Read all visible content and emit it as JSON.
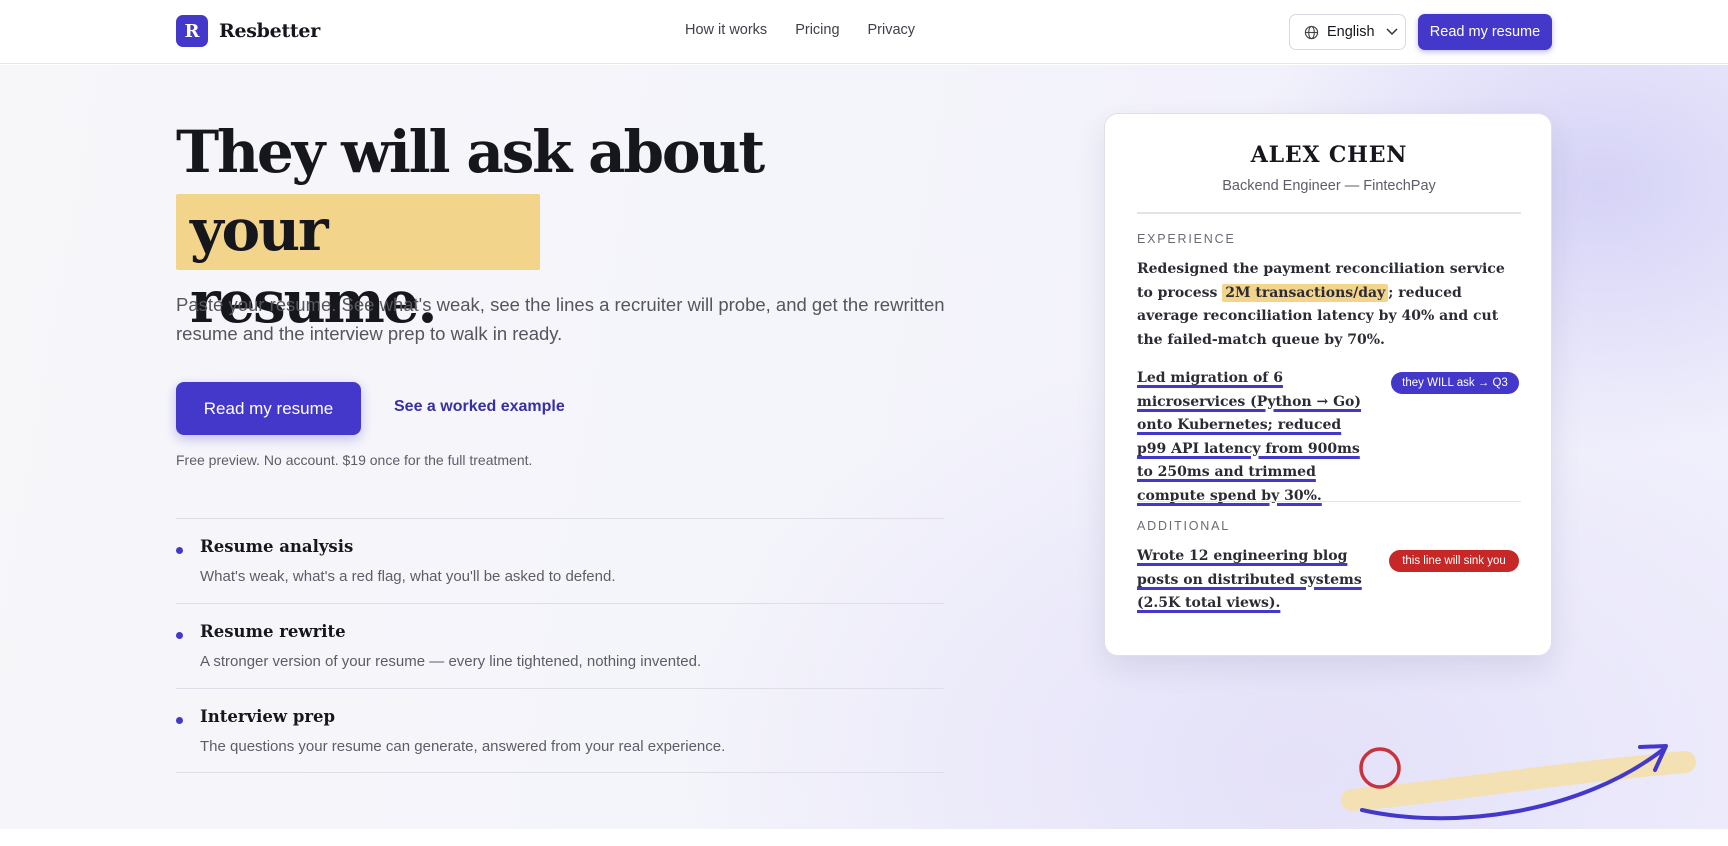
{
  "brand": {
    "mark": "R",
    "name": "Resbetter"
  },
  "nav": {
    "links": [
      "How it works",
      "Pricing",
      "Privacy"
    ],
    "language": "English",
    "cta": "Read my resume"
  },
  "hero": {
    "headline_line1": "They will ask about",
    "headline_line2": "your resume.",
    "lead": "Paste your resume. See what's weak, see the lines a recruiter will probe, and get the rewritten resume and the interview prep to walk in ready.",
    "cta_primary": "Read my resume",
    "cta_secondary": "See a worked example",
    "fine_print": "Free preview. No account. $19 once for the full treatment."
  },
  "features": [
    {
      "title": "Resume analysis",
      "desc": "What's weak, what's a red flag, what you'll be asked to defend."
    },
    {
      "title": "Resume rewrite",
      "desc": "A stronger version of your resume — every line tightened, nothing invented."
    },
    {
      "title": "Interview prep",
      "desc": "The questions your resume can generate, answered from your real experience."
    }
  ],
  "resume_card": {
    "name": "ALEX CHEN",
    "role": "Backend Engineer — FintechPay",
    "section_experience": "EXPERIENCE",
    "bullet1": {
      "before": "Redesigned the payment reconciliation service to process",
      "highlight": "2M transactions/day",
      "after": "; reduced average reconciliation latency by 40% and cut the failed-match queue by 70%."
    },
    "bullet2": "Led migration of 6 microservices (Python → Go) onto Kubernetes; reduced p99 API latency from 900ms to 250ms and trimmed compute spend by 30%.",
    "tag_probe": "they WILL ask → Q3",
    "section_additional": "ADDITIONAL",
    "bullet3": "Wrote 12 engineering blog posts on distributed systems (2.5K total views).",
    "tag_sink": "this line will sink you"
  },
  "colors": {
    "accent": "#4338ca",
    "highlight": "#f2d48b",
    "danger": "#c62828"
  }
}
